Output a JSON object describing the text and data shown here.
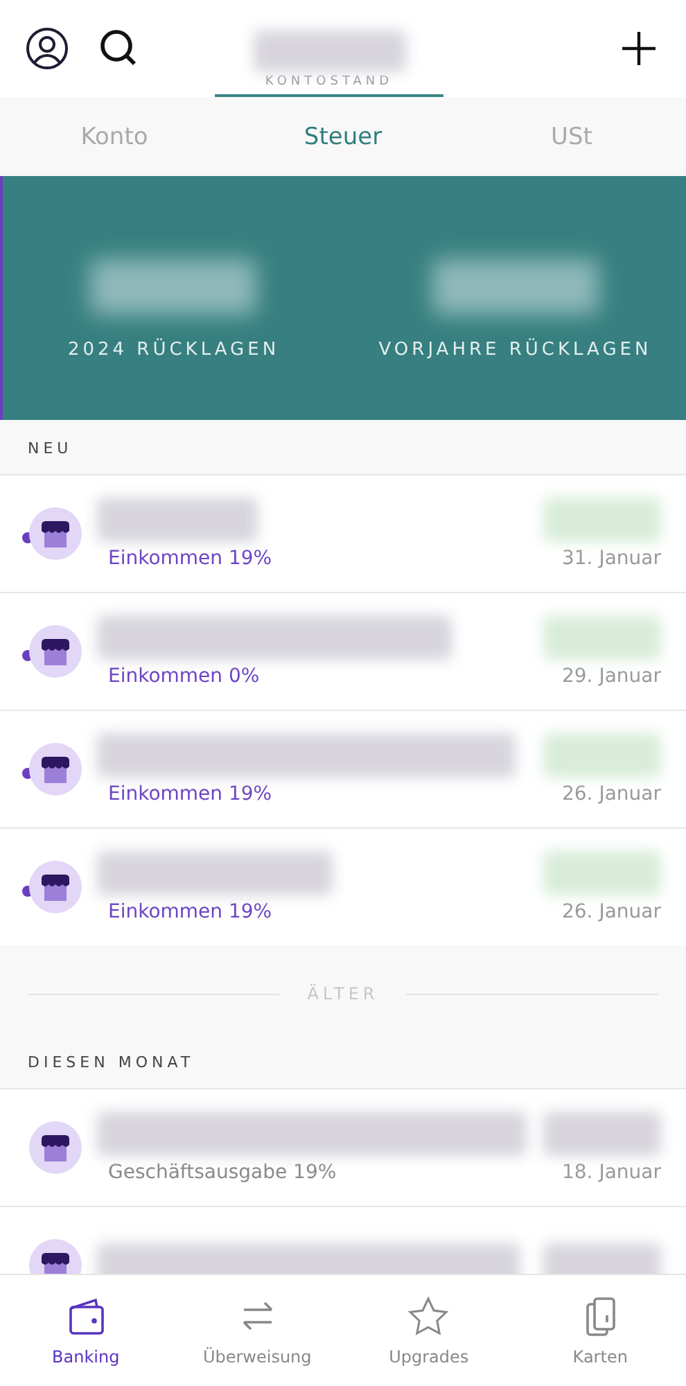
{
  "header": {
    "balance_label": "KONTOSTAND"
  },
  "tabs": [
    {
      "label": "Konto",
      "selected": false
    },
    {
      "label": "Steuer",
      "selected": true
    },
    {
      "label": "USt",
      "selected": false
    }
  ],
  "reserves": [
    {
      "label": "2024 RÜCKLAGEN"
    },
    {
      "label": "VORJAHRE RÜCKLAGEN"
    }
  ],
  "sections": [
    {
      "title": "NEU",
      "rows": [
        {
          "unread": true,
          "kind": "income",
          "category": "Einkommen 19%",
          "date": "31. Januar"
        },
        {
          "unread": true,
          "kind": "income",
          "category": "Einkommen 0%",
          "date": "29. Januar"
        },
        {
          "unread": true,
          "kind": "income",
          "category": "Einkommen 19%",
          "date": "26. Januar"
        },
        {
          "unread": true,
          "kind": "income",
          "category": "Einkommen 19%",
          "date": "26. Januar"
        }
      ]
    },
    {
      "divider": "ÄLTER",
      "title": "DIESEN MONAT",
      "rows": [
        {
          "unread": false,
          "kind": "expense",
          "category": "Geschäftsausgabe 19%",
          "date": "18. Januar"
        },
        {
          "unread": false
        }
      ]
    }
  ],
  "nav": [
    {
      "label": "Banking",
      "kind": "wallet",
      "selected": true
    },
    {
      "label": "Überweisung",
      "kind": "transfer",
      "selected": false
    },
    {
      "label": "Upgrades",
      "kind": "star",
      "selected": false
    },
    {
      "label": "Karten",
      "kind": "cards",
      "selected": false
    }
  ]
}
